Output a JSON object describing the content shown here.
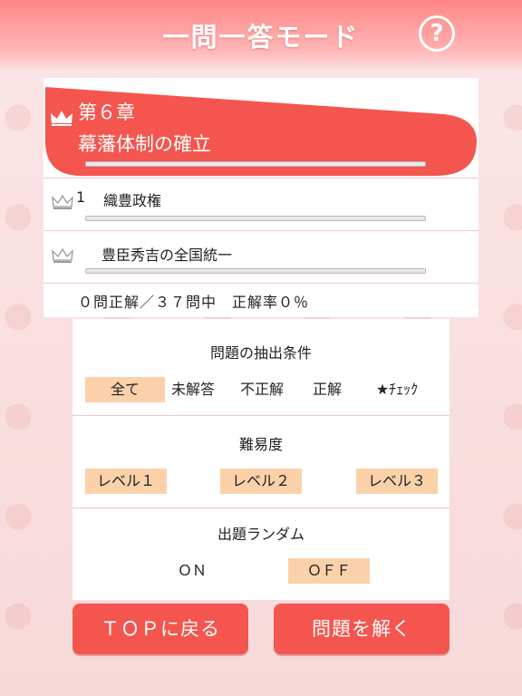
{
  "header": {
    "title": "一問一答モード",
    "help_label": "?"
  },
  "chapter": {
    "number": "第６章",
    "title": "幕藩体制の確立"
  },
  "sections": [
    {
      "number": "1",
      "title": "織豊政権"
    },
    {
      "number": "",
      "title": "豊臣秀吉の全国統一"
    }
  ],
  "stats": "０問正解／３７問中　正解率０％",
  "filter": {
    "heading": "問題の抽出条件",
    "options": [
      "全て",
      "未解答",
      "不正解",
      "正解",
      "★ﾁｪｯｸ"
    ],
    "selected": "全て"
  },
  "difficulty": {
    "heading": "難易度",
    "options": [
      "レベル１",
      "レベル２",
      "レベル３"
    ]
  },
  "random": {
    "heading": "出題ランダム",
    "on_label": "ＯＮ",
    "off_label": "ＯＦＦ",
    "selected": "OFF"
  },
  "buttons": {
    "top": "ＴＯＰに戻る",
    "solve": "問題を解く"
  },
  "colors": {
    "accent": "#f4564f",
    "selected": "#fbd1a9"
  }
}
